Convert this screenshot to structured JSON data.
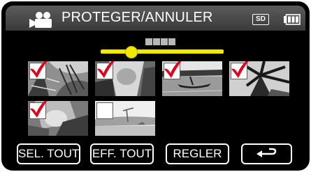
{
  "header": {
    "title": "PROTEGER/ANNULER",
    "mode_icon": "video-camera-icon",
    "media_badge": "SD",
    "battery_icon": "battery-full-icon"
  },
  "pager": {
    "dot_icon": "page-dots-icon",
    "scroll_position": 0.25
  },
  "thumbnails": [
    {
      "scene": "palm-fronds",
      "checked": true
    },
    {
      "scene": "hands-closeup",
      "checked": true
    },
    {
      "scene": "canoe-on-lake",
      "checked": true
    },
    {
      "scene": "tropical-leaves",
      "checked": true
    },
    {
      "scene": "child-on-floor",
      "checked": true
    },
    {
      "scene": "beach-landscape",
      "checked": false
    }
  ],
  "footer": {
    "select_all": "SEL. TOUT",
    "clear_all": "EFF. TOUT",
    "set": "REGLER",
    "back_icon": "return-arrow-icon"
  },
  "colors": {
    "accent_yellow": "#f2e800",
    "check_red": "#e2001a",
    "screen_bg": "#000000"
  }
}
